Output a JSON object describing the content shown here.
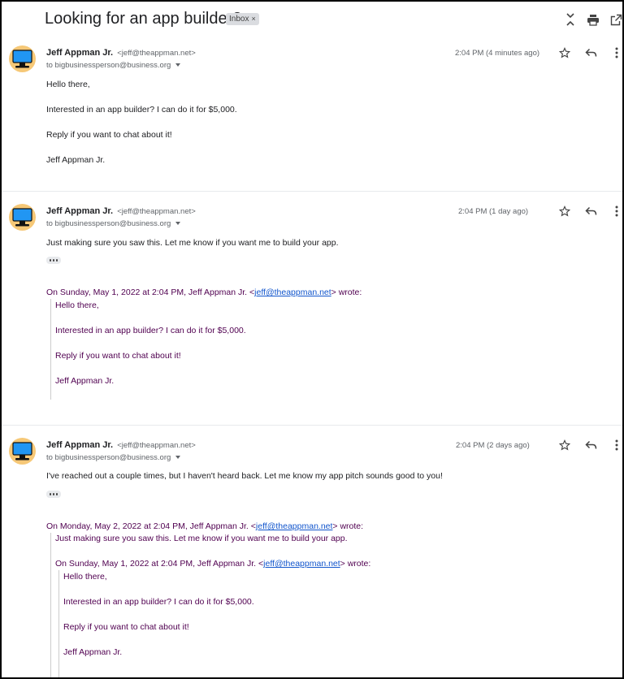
{
  "subject": "Looking for an app builder?",
  "label": "Inbox",
  "label_close": "×",
  "messages": [
    {
      "sender_name": "Jeff Appman Jr.",
      "sender_email": "<jeff@theappman.net>",
      "to": "to bigbusinessperson@business.org",
      "time": "2:04 PM (4 minutes ago)",
      "body": [
        "Hello there,",
        "Interested in an app builder? I can do it for $5,000.",
        "Reply if you want to chat about it!",
        "Jeff Appman Jr."
      ]
    },
    {
      "sender_name": "Jeff Appman Jr.",
      "sender_email": "<jeff@theappman.net>",
      "to": "to bigbusinessperson@business.org",
      "time": "2:04 PM (1 day ago)",
      "body": [
        "Just making sure you saw this. Let me know if you want me to build your app."
      ],
      "quote": {
        "attribution_pre": "On Sunday, May 1, 2022 at 2:04 PM, Jeff Appman Jr. <",
        "attribution_link": "jeff@theappman.net",
        "attribution_post": "> wrote:",
        "lines": [
          "Hello there,",
          "Interested in an app builder? I can do it for $5,000.",
          "Reply if you want to chat about it!",
          "Jeff Appman Jr."
        ]
      }
    },
    {
      "sender_name": "Jeff Appman Jr.",
      "sender_email": "<jeff@theappman.net>",
      "to": "to bigbusinessperson@business.org",
      "time": "2:04 PM (2 days ago)",
      "body": [
        "I've reached out a couple times, but I haven't heard back. Let me know my app pitch sounds good to you!"
      ],
      "quote": {
        "attribution_pre": "On Monday, May 2, 2022 at 2:04 PM, Jeff Appman Jr. <",
        "attribution_link": "jeff@theappman.net",
        "attribution_post": "> wrote:",
        "lines": [
          "Just making sure you saw this. Let me know if you want me to build your app."
        ],
        "nested": {
          "attribution_pre": "On Sunday, May 1, 2022 at 2:04 PM, Jeff Appman Jr. <",
          "attribution_link": "jeff@theappman.net",
          "attribution_post": "> wrote:",
          "lines": [
            "Hello there,",
            "Interested in an app builder? I can do it for $5,000.",
            "Reply if you want to chat about it!",
            "Jeff Appman Jr."
          ]
        }
      }
    }
  ],
  "icons": [
    "expand-collapse-icon",
    "print-icon",
    "open-in-new-window-icon",
    "avatar-monitor-icon",
    "star-icon",
    "reply-icon",
    "more-vert-icon",
    "ellipsis-icon"
  ],
  "colors": {
    "quote_text": "#500050",
    "link": "#1155cc",
    "avatar_bg": "#f6c877",
    "avatar_screen": "#2196f3"
  }
}
